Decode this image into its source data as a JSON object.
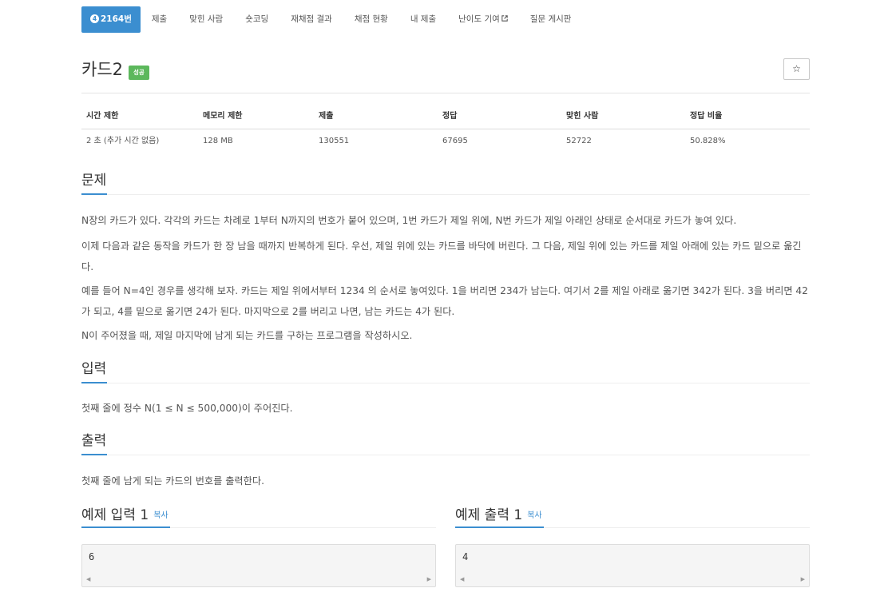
{
  "nav": {
    "problem_badge": "4",
    "problem_number": "2164번",
    "items": [
      "제출",
      "맞힌 사람",
      "숏코딩",
      "재채점 결과",
      "채점 현황",
      "내 제출",
      "난이도 기여",
      "질문 게시판"
    ],
    "external_icon": "external-link-icon"
  },
  "title": "카드2",
  "status_badge": "성공",
  "star_icon": "☆",
  "stats": {
    "headers": [
      "시간 제한",
      "메모리 제한",
      "제출",
      "정답",
      "맞힌 사람",
      "정답 비율"
    ],
    "values": [
      "2 초 (추가 시간 없음)",
      "128 MB",
      "130551",
      "67695",
      "52722",
      "50.828%"
    ]
  },
  "sections": {
    "problem": {
      "title": "문제",
      "paragraphs": [
        "N장의 카드가 있다. 각각의 카드는 차례로 1부터 N까지의 번호가 붙어 있으며, 1번 카드가 제일 위에, N번 카드가 제일 아래인 상태로 순서대로 카드가 놓여 있다.",
        "이제 다음과 같은 동작을 카드가 한 장 남을 때까지 반복하게 된다. 우선, 제일 위에 있는 카드를 바닥에 버린다. 그 다음, 제일 위에 있는 카드를 제일 아래에 있는 카드 밑으로 옮긴다.",
        "예를 들어 N=4인 경우를 생각해 보자. 카드는 제일 위에서부터 1234 의 순서로 놓여있다. 1을 버리면 234가 남는다. 여기서 2를 제일 아래로 옮기면 342가 된다. 3을 버리면 42가 되고, 4를 밑으로 옮기면 24가 된다. 마지막으로 2를 버리고 나면, 남는 카드는 4가 된다.",
        "N이 주어졌을 때, 제일 마지막에 남게 되는 카드를 구하는 프로그램을 작성하시오."
      ]
    },
    "input": {
      "title": "입력",
      "text": "첫째 줄에 정수 N(1 ≤ N ≤ 500,000)이 주어진다."
    },
    "output": {
      "title": "출력",
      "text": "첫째 줄에 남게 되는 카드의 번호를 출력한다."
    }
  },
  "examples": {
    "input": {
      "title": "예제 입력 1",
      "copy_label": "복사",
      "value": "6"
    },
    "output": {
      "title": "예제 출력 1",
      "copy_label": "복사",
      "value": "4"
    }
  }
}
